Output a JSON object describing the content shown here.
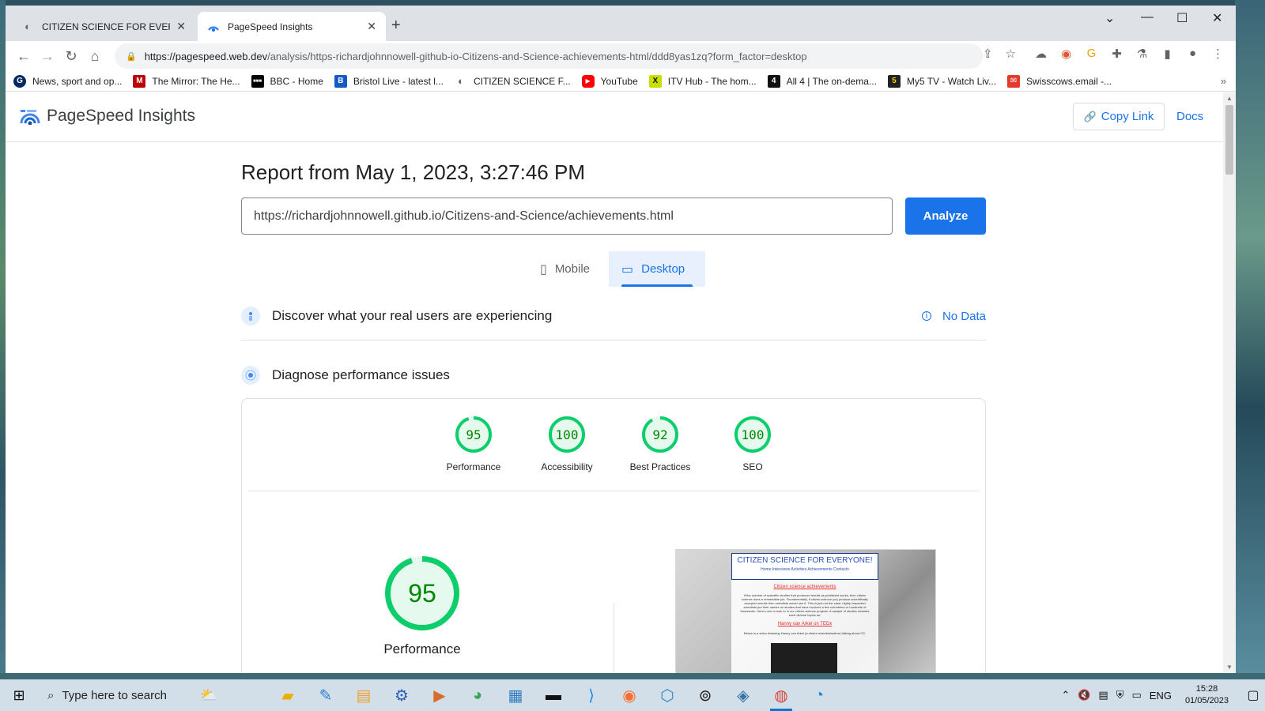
{
  "browser": {
    "tabs": [
      {
        "title": "CITIZEN SCIENCE FOR EVERYONE",
        "icon": "globe-icon",
        "active": false
      },
      {
        "title": "PageSpeed Insights",
        "icon": "pagespeed-icon",
        "active": true
      }
    ],
    "url_host": "https://pagespeed.web.dev",
    "url_path": "/analysis/https-richardjohnnowell-github-io-Citizens-and-Science-achievements-html/ddd8yas1zq?form_factor=desktop",
    "bookmarks": [
      {
        "label": "News, sport and op...",
        "icon": "guardian-icon",
        "color": "#052962",
        "glyph": "G"
      },
      {
        "label": "The Mirror: The He...",
        "icon": "mirror-icon",
        "color": "#c00000",
        "glyph": "M"
      },
      {
        "label": "BBC - Home",
        "icon": "bbc-icon",
        "color": "#000000",
        "glyph": "■"
      },
      {
        "label": "Bristol Live - latest l...",
        "icon": "bristol-live-icon",
        "color": "#1559c9",
        "glyph": "B"
      },
      {
        "label": "CITIZEN SCIENCE F...",
        "icon": "globe-icon",
        "color": "#5f6368",
        "glyph": "◐"
      },
      {
        "label": "YouTube",
        "icon": "youtube-icon",
        "color": "#ff0000",
        "glyph": "▶"
      },
      {
        "label": "ITV Hub - The hom...",
        "icon": "itv-icon",
        "color": "#c6e000",
        "glyph": "X"
      },
      {
        "label": "All 4 | The on-dema...",
        "icon": "all4-icon",
        "color": "#111111",
        "glyph": "4"
      },
      {
        "label": "My5 TV - Watch Liv...",
        "icon": "my5-icon",
        "color": "#222222",
        "glyph": "5"
      },
      {
        "label": "Swisscows.email -...",
        "icon": "swisscows-icon",
        "color": "#e33a2c",
        "glyph": "✉"
      }
    ]
  },
  "psi": {
    "brand": "PageSpeed Insights",
    "copy_link": "Copy Link",
    "docs": "Docs",
    "report_title": "Report from May 1, 2023, 3:27:46 PM",
    "url_value": "https://richardjohnnowell.github.io/Citizens-and-Science/achievements.html",
    "analyze": "Analyze",
    "form_tabs": {
      "mobile": "Mobile",
      "desktop": "Desktop",
      "selected": "Desktop"
    },
    "real_users": "Discover what your real users are experiencing",
    "no_data": "No Data",
    "diagnose": "Diagnose performance issues",
    "scores": [
      {
        "label": "Performance",
        "value": 95
      },
      {
        "label": "Accessibility",
        "value": 100
      },
      {
        "label": "Best Practices",
        "value": 92
      },
      {
        "label": "SEO",
        "value": 100
      }
    ],
    "main_score": {
      "label": "Performance",
      "value": 95
    },
    "pass_color": "#0cce6b",
    "pass_text_color": "#008800",
    "preview": {
      "site_title": "CITIZEN SCIENCE FOR EVERYONE!",
      "nav": "Home  Interviews  Activities  Achievements  Contacts",
      "subtitle": "Citizen science achievements",
      "body": "If the number of scientific studies that produced results as published works, then citizen science does a remarkable job. Fundamentally, if citizen science (cs) produce scientifically accepted results then scientists would use it. This is just not the case: highly respected scientists put their names on studies that have involved a few volunteers or hundreds of thousands. Here's one to look to in our citizen science projects. A sample of studies includes such diverse topics as:",
      "link": "Hanny van Arkel on TEDx",
      "body2": "Below is a video featuring Hanny van Arkel (a citizen scientist/author) talking about CS."
    }
  },
  "taskbar": {
    "search_placeholder": "Type here to search",
    "apps": [
      "file-explorer-icon",
      "paint-icon",
      "notepad-icon",
      "teams-icon",
      "media-icon",
      "color-picker-icon",
      "settings-icon",
      "terminal-icon",
      "vscode-icon",
      "firefox-icon",
      "app-icon",
      "vpn-icon",
      "python-icon",
      "chrome-icon",
      "edge-icon"
    ],
    "language": "ENG",
    "time": "15:28",
    "date": "01/05/2023"
  }
}
